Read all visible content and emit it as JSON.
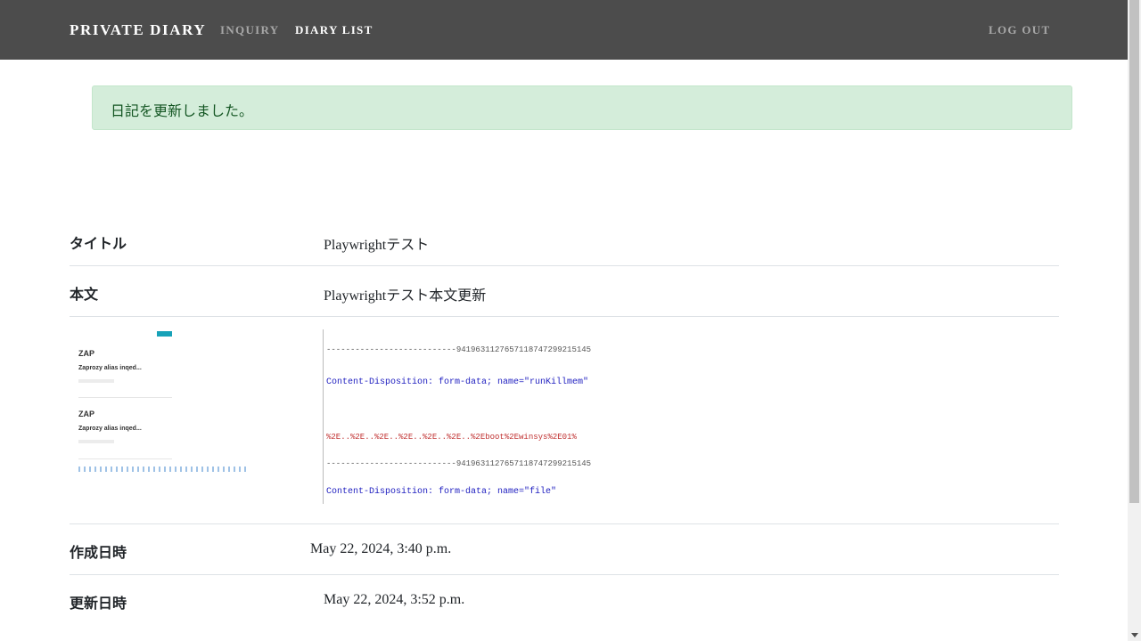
{
  "nav": {
    "brand": "PRIVATE DIARY",
    "links": [
      "INQUIRY",
      "DIARY LIST"
    ],
    "logout": "LOG OUT"
  },
  "alert": {
    "message": "日記を更新しました。"
  },
  "detail": {
    "title_label": "タイトル",
    "title_value": "Playwrightテスト",
    "body_label": "本文",
    "body_value": "Playwrightテスト本文更新",
    "created_label": "作成日時",
    "created_value": "May 22, 2024, 3:40 p.m.",
    "updated_label": "更新日時",
    "updated_value": "May 22, 2024, 3:52 p.m."
  },
  "thumbnails": {
    "left": {
      "entries": [
        {
          "title": "ZAP",
          "subtitle": "Zaprozy alias inqed..."
        },
        {
          "title": "ZAP",
          "subtitle": "Zaprozy alias inqed..."
        }
      ]
    },
    "right": {
      "lines": [
        "---------------------------9419631127657118747299215145",
        "Content-Disposition: form-data; name=\"runKillmem\"",
        "",
        "%2E..%2E..%2E..%2E..%2E..%2E..%2Eboot%2Ewinsys%2E01%",
        "---------------------------9419631127657118747299215145",
        "Content-Disposition: form-data; name=\"file\""
      ]
    }
  },
  "colors": {
    "navbar": "#4c4c4c",
    "alert_bg": "#d4edda",
    "alert_text": "#155724"
  }
}
